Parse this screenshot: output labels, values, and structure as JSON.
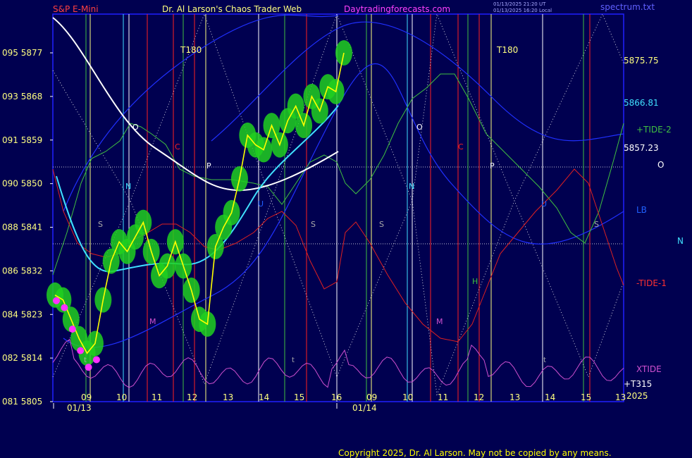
{
  "header": {
    "left": "S&P E-Mini",
    "center": "Dr. Al Larson's Chaos Trader Web",
    "site": "Daytradingforecasts.com",
    "stamp1": "01/13/2025 21:20 UT",
    "stamp2": "01/13/2025 16:20 Local",
    "right": "spectrum.txt"
  },
  "colors": {
    "background": "#000050",
    "frame": "#2020ff",
    "price": "#ffff00",
    "ma_white": "#ffffff",
    "ma_cyan": "#40e0ff",
    "tide2": "#40c040",
    "tide1": "#e02020",
    "xtide": "#d050d0",
    "glow": "#20e020"
  },
  "chart_data": {
    "type": "line",
    "title": "S&P E-Mini",
    "ylim": [
      5805,
      5885
    ],
    "y_ticks": [
      {
        "code": "095",
        "value": 5877
      },
      {
        "code": "093",
        "value": 5868
      },
      {
        "code": "091",
        "value": 5859
      },
      {
        "code": "090",
        "value": 5850
      },
      {
        "code": "088",
        "value": 5841
      },
      {
        "code": "086",
        "value": 5832
      },
      {
        "code": "084",
        "value": 5823
      },
      {
        "code": "082",
        "value": 5814
      },
      {
        "code": "081",
        "value": 5805
      }
    ],
    "x_ticks": [
      "09",
      "10",
      "11",
      "12",
      "13",
      "14",
      "15",
      "16",
      "09",
      "10",
      "11",
      "12",
      "13",
      "14",
      "15",
      "13"
    ],
    "date_labels": [
      "01/13",
      "01/14"
    ],
    "right_labels": [
      "5875.75",
      "5866.81",
      "5857.23"
    ],
    "price_series": {
      "name": "price",
      "values": [
        5827,
        5826,
        5822,
        5818,
        5815,
        5817,
        5826,
        5834,
        5838,
        5836,
        5839,
        5842,
        5836,
        5831,
        5833,
        5838,
        5833,
        5828,
        5822,
        5821,
        5837,
        5841,
        5844,
        5851,
        5860,
        5858,
        5857,
        5862,
        5858,
        5863,
        5866,
        5862,
        5868,
        5865,
        5870,
        5869,
        5877
      ]
    }
  },
  "annotations": {
    "t180_left": "T180",
    "t180_right": "T180",
    "tide2": "+TIDE-2",
    "tide1": "-TIDE-1",
    "xtide": "XTIDE",
    "lb": "LB",
    "t315": "+T315",
    "year": "2025",
    "o_right": "O",
    "n_right": "N",
    "planets_left": [
      "O",
      "C",
      "P",
      "N",
      "S",
      "U",
      "S",
      "M"
    ],
    "planets_right": [
      "O",
      "C",
      "P",
      "N",
      "S",
      "U",
      "S",
      "M",
      "H",
      "t",
      "t",
      "t"
    ]
  },
  "copyright": "Copyright 2025, Dr. Al Larson. May not be copied by any means."
}
